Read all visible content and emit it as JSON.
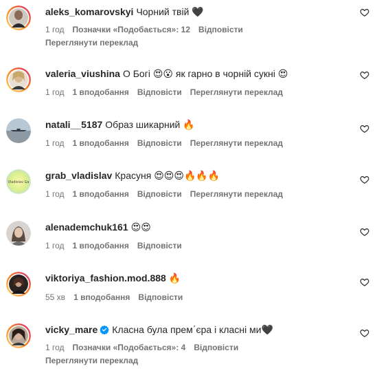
{
  "comments": [
    {
      "username": "aleks_komarovskyi",
      "text": "Чорний твій 🖤",
      "time": "1 год",
      "likes": "Позначки «Подобається»: 12",
      "reply": "Відповісти",
      "translate": "Переглянути переклад"
    },
    {
      "username": "valeria_viushina",
      "text": "О Богі 😍😮 як гарно в чорній сукні 😍",
      "time": "1 год",
      "likes": "1 вподобання",
      "reply": "Відповісти",
      "translate": "Переглянути переклад"
    },
    {
      "username": "natali__5187",
      "text": "Образ шикарний 🔥",
      "time": "1 год",
      "likes": "1 вподобання",
      "reply": "Відповісти",
      "translate": "Переглянути переклад"
    },
    {
      "username": "grab_vladislav",
      "text": "Красуня 😍😍😍🔥🔥🔥",
      "time": "1 год",
      "likes": "1 вподобання",
      "reply": "Відповісти",
      "translate": "Переглянути переклад",
      "avatar_text": "Vladislav Ga"
    },
    {
      "username": "alenademchuk161",
      "text": "😍😍",
      "time": "1 год",
      "likes": "1 вподобання",
      "reply": "Відповісти"
    },
    {
      "username": "viktoriya_fashion.mod.888",
      "text": "🔥",
      "time": "55 хв",
      "likes": "1 вподобання",
      "reply": "Відповісти"
    },
    {
      "username": "vicky_mare",
      "text": "Класна була прем΄єра і класні ми🖤",
      "time": "1 год",
      "likes": "Позначки «Подобається»: 4",
      "reply": "Відповісти",
      "translate": "Переглянути переклад"
    }
  ],
  "colors": {
    "text": "#262626",
    "secondary": "#737373",
    "verified": "#0095f6",
    "story_ring_start": "#feda75",
    "story_ring_end": "#d62976"
  },
  "icons": {
    "like": "heart-outline-icon",
    "verified": "verified-badge-icon"
  }
}
